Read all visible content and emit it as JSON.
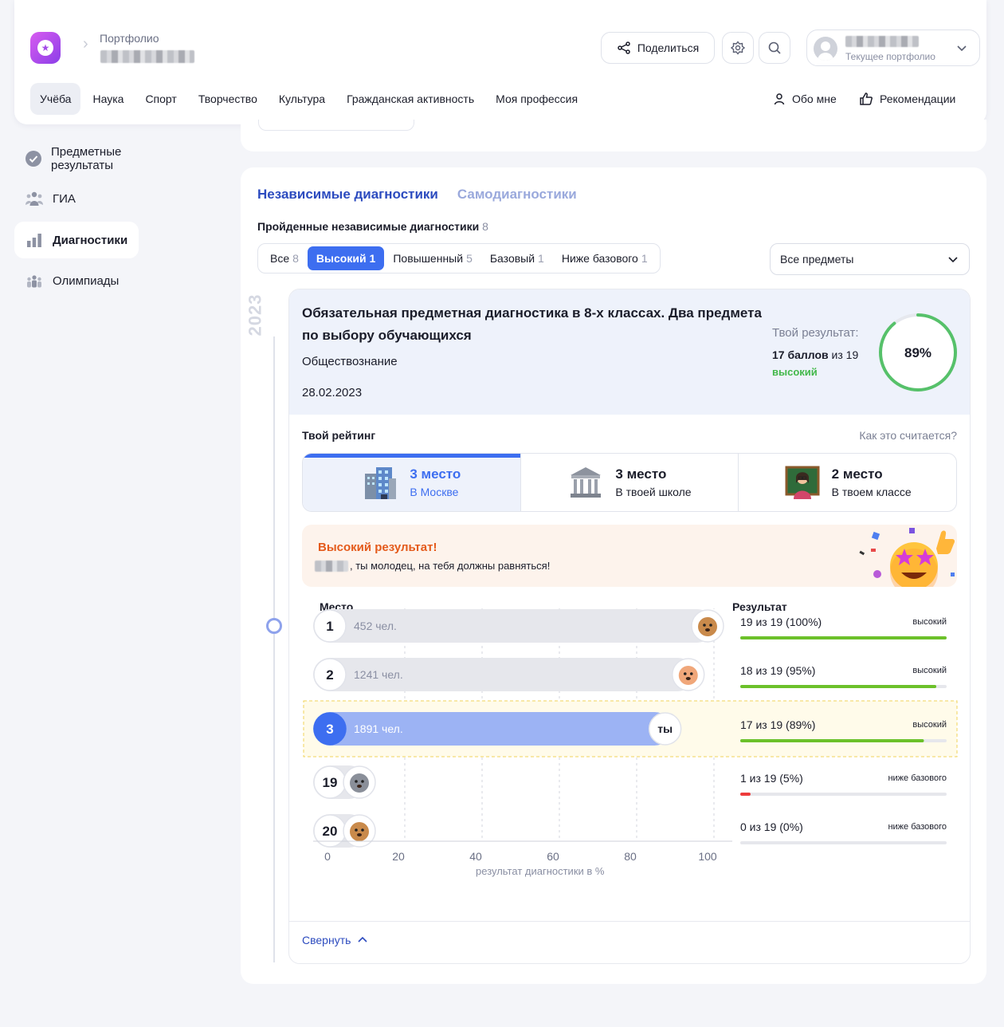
{
  "header": {
    "portfolio_label": "Портфолио",
    "share_label": "Поделиться",
    "user_subtitle": "Текущее портфолио"
  },
  "nav": {
    "items": [
      "Учёба",
      "Наука",
      "Спорт",
      "Творчество",
      "Культура",
      "Гражданская активность",
      "Моя профессия"
    ],
    "active": "Учёба",
    "about": "Обо мне",
    "recommendations": "Рекомендации"
  },
  "sidebar": {
    "items": [
      {
        "label": "Предметные результаты",
        "icon": "check-badge-icon"
      },
      {
        "label": "ГИА",
        "icon": "people-icon"
      },
      {
        "label": "Диагностики",
        "icon": "bar-chart-icon"
      },
      {
        "label": "Олимпиады",
        "icon": "group-icon"
      }
    ],
    "active": "Диагностики"
  },
  "diagnostics": {
    "tab_independent": "Независимые диагностики",
    "tab_self": "Самодиагностики",
    "passed_title": "Пройденные независимые диагностики",
    "passed_count": "8",
    "filters": [
      {
        "label": "Все",
        "count": "8"
      },
      {
        "label": "Высокий",
        "count": "1"
      },
      {
        "label": "Повышенный",
        "count": "5"
      },
      {
        "label": "Базовый",
        "count": "1"
      },
      {
        "label": "Ниже базового",
        "count": "1"
      }
    ],
    "active_filter": "Высокий",
    "subject_select": "Все предметы",
    "year": "2023"
  },
  "card": {
    "title": "Обязательная предметная диагностика в 8-х классах. Два предмета по выбору обучающихся",
    "subject": "Обществознание",
    "date": "28.02.2023",
    "result_label": "Твой результат:",
    "result_score": "17 баллов",
    "result_of": "из 19",
    "result_level": "высокий",
    "result_percent": "89%",
    "result_percent_value": 89,
    "rating_title": "Твой рейтинг",
    "how_link": "Как это считается?",
    "places": [
      {
        "place": "3 место",
        "where": "В Москве",
        "icon": "city-building-icon"
      },
      {
        "place": "3 место",
        "where": "В твоей школе",
        "icon": "school-building-icon"
      },
      {
        "place": "2 место",
        "where": "В твоем классе",
        "icon": "teacher-icon"
      }
    ],
    "banner_title": "Высокий результат!",
    "banner_text": ", ты молодец, на тебя должны равняться!",
    "collapse": "Свернуть"
  },
  "chart_data": {
    "type": "bar",
    "xlabel": "результат диагностики в %",
    "col_place": "Место",
    "col_result": "Результат",
    "xlim": [
      0,
      100
    ],
    "x_ticks": [
      "0",
      "20",
      "40",
      "60",
      "80",
      "100"
    ],
    "rows": [
      {
        "place": "1",
        "people": "452 чел.",
        "value": 100,
        "result": "19 из 19 (100%)",
        "level": "высокий",
        "avatar": "dog-icon",
        "crown": true
      },
      {
        "place": "2",
        "people": "1241 чел.",
        "value": 95,
        "result": "18 из 19 (95%)",
        "level": "высокий",
        "avatar": "hamster-icon"
      },
      {
        "place": "3",
        "people": "1891 чел.",
        "value": 89,
        "result": "17 из 19 (89%)",
        "level": "высокий",
        "avatar": "ты",
        "me": true
      },
      {
        "place": "19",
        "people": "",
        "value": 5,
        "result": "1 из 19 (5%)",
        "level": "ниже базового",
        "avatar": "raccoon-icon"
      },
      {
        "place": "20",
        "people": "",
        "value": 0,
        "result": "0 из 19 (0%)",
        "level": "ниже базового",
        "avatar": "dog-icon"
      }
    ],
    "colors": {
      "bar": "#e6e7ec",
      "me_bar": "#9cb3f4",
      "me_badge": "#3d6ef0",
      "high": "#6cc12a",
      "low": "#ee3b3b",
      "track": "#e6e7ec"
    }
  }
}
